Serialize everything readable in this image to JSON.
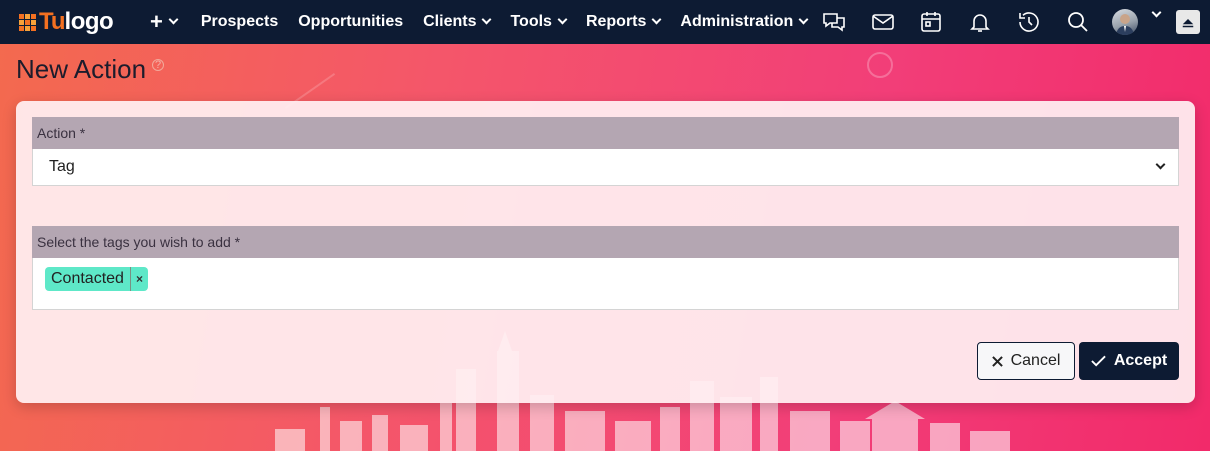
{
  "logo": {
    "part1": "Tu",
    "part2": "logo"
  },
  "nav": {
    "plus_label": "+",
    "items": [
      {
        "label": "Prospects",
        "has_dropdown": false
      },
      {
        "label": "Opportunities",
        "has_dropdown": false
      },
      {
        "label": "Clients",
        "has_dropdown": true
      },
      {
        "label": "Tools",
        "has_dropdown": true
      },
      {
        "label": "Reports",
        "has_dropdown": true
      },
      {
        "label": "Administration",
        "has_dropdown": true
      }
    ],
    "icons": [
      "chat-icon",
      "mail-icon",
      "calendar-icon",
      "bell-icon",
      "history-icon",
      "search-icon",
      "avatar",
      "chevron-down-icon",
      "collapse-up-icon"
    ]
  },
  "page": {
    "title": "New Action",
    "help_icon": "?"
  },
  "form": {
    "action_label": "Action *",
    "action_value": "Tag",
    "tags_label": "Select the tags you wish to add *",
    "tags": [
      {
        "label": "Contacted",
        "remove": "×"
      }
    ]
  },
  "buttons": {
    "cancel_label": "Cancel",
    "accept_label": "Accept"
  },
  "colors": {
    "navbar": "#0d1b33",
    "accent": "#f37021",
    "tag": "#5ee8c8",
    "label_bar": "#b4a6b2",
    "primary_button": "#0d1b33"
  }
}
